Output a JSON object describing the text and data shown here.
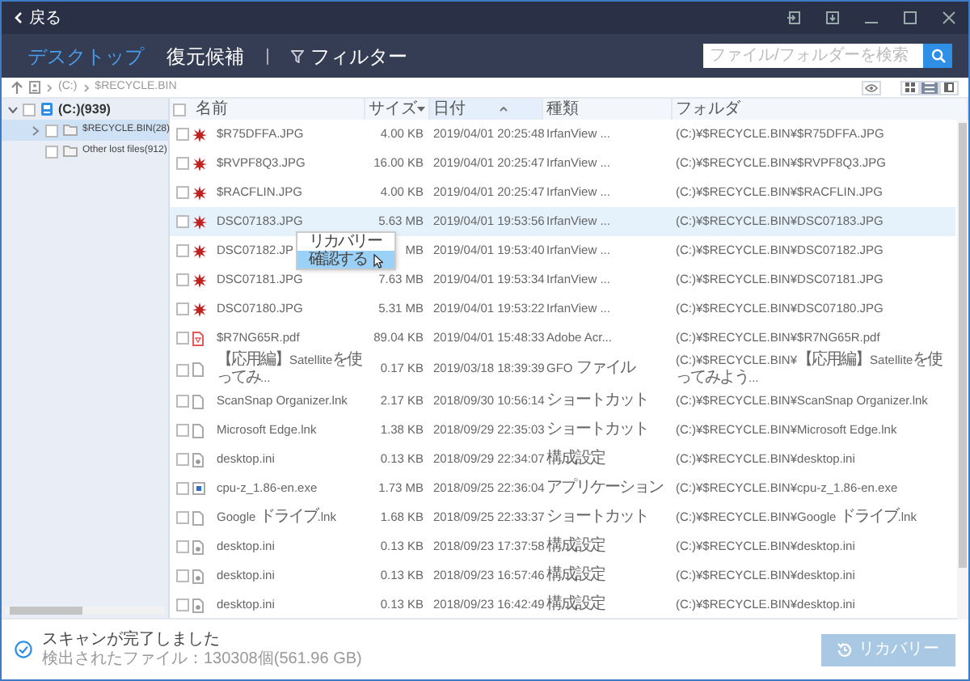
{
  "window": {
    "back": "戻る"
  },
  "tabs": [
    {
      "label": "デスクトップ",
      "selected": true
    },
    {
      "label": "復元候補",
      "selected": false
    }
  ],
  "filter": {
    "label": "フィルター"
  },
  "search": {
    "placeholder": "ファイル/フォルダーを検索"
  },
  "breadcrumb": [
    "(C:)",
    "$RECYCLE.BIN"
  ],
  "views": [
    {
      "kind": "grid",
      "selected": false
    },
    {
      "kind": "list",
      "selected": true
    },
    {
      "kind": "panel",
      "selected": false
    }
  ],
  "tree": [
    {
      "label": "(C:)(939)",
      "kind": "drive",
      "checked": false,
      "selected": false,
      "expanded": true,
      "children": [
        {
          "label": "$RECYCLE.BIN(28)",
          "kind": "folder",
          "checked": false,
          "selected": true,
          "expanded": false
        },
        {
          "label": "Other lost files(912)",
          "kind": "folder",
          "checked": false,
          "selected": false
        }
      ]
    }
  ],
  "table": {
    "select_all": {
      "checked": false
    },
    "columns": [
      {
        "label": "名前",
        "dropdown": false,
        "sorted": false
      },
      {
        "label": "サイズ",
        "dropdown": true,
        "sorted": false
      },
      {
        "label": "日付",
        "dropdown": false,
        "sorted": true
      },
      {
        "label": "種類",
        "dropdown": false,
        "sorted": false
      },
      {
        "label": "フォルダ",
        "dropdown": false,
        "sorted": false
      }
    ],
    "rows": [
      {
        "kind": "image",
        "name": "$R75DFFA.JPG",
        "size": "4.00 KB",
        "date": "2019/04/01 20:25:48",
        "type": "IrfanView ...",
        "folder": "(C:)¥$RECYCLE.BIN¥$R75DFFA.JPG",
        "checked": false,
        "selected": false
      },
      {
        "kind": "image",
        "name": "$RVPF8Q3.JPG",
        "size": "16.00 KB",
        "date": "2019/04/01 20:25:47",
        "type": "IrfanView ...",
        "folder": "(C:)¥$RECYCLE.BIN¥$RVPF8Q3.JPG",
        "checked": false,
        "selected": false
      },
      {
        "kind": "image",
        "name": "$RACFLIN.JPG",
        "size": "4.00 KB",
        "date": "2019/04/01 20:25:47",
        "type": "IrfanView ...",
        "folder": "(C:)¥$RECYCLE.BIN¥$RACFLIN.JPG",
        "checked": false,
        "selected": false
      },
      {
        "kind": "image",
        "name": "DSC07183.JPG",
        "size": "5.63 MB",
        "date": "2019/04/01 19:53:56",
        "type": "IrfanView ...",
        "folder": "(C:)¥$RECYCLE.BIN¥DSC07183.JPG",
        "checked": false,
        "selected": true
      },
      {
        "kind": "image",
        "name": "DSC07182.JP",
        "size": "MB",
        "date": "2019/04/01 19:53:40",
        "type": "IrfanView ...",
        "folder": "(C:)¥$RECYCLE.BIN¥DSC07182.JPG",
        "checked": false,
        "selected": false
      },
      {
        "kind": "image",
        "name": "DSC07181.JPG",
        "size": "7.63 MB",
        "date": "2019/04/01 19:53:34",
        "type": "IrfanView ...",
        "folder": "(C:)¥$RECYCLE.BIN¥DSC07181.JPG",
        "checked": false,
        "selected": false
      },
      {
        "kind": "image",
        "name": "DSC07180.JPG",
        "size": "5.31 MB",
        "date": "2019/04/01 19:53:22",
        "type": "IrfanView ...",
        "folder": "(C:)¥$RECYCLE.BIN¥DSC07180.JPG",
        "checked": false,
        "selected": false
      },
      {
        "kind": "pdf",
        "name": "$R7NG65R.pdf",
        "size": "89.04 KB",
        "date": "2019/04/01 15:48:33",
        "type": "Adobe Acr...",
        "folder": "(C:)¥$RECYCLE.BIN¥$R7NG65R.pdf",
        "checked": false,
        "selected": false
      },
      {
        "kind": "doc",
        "name": "【応用編】Satelliteを使ってみ...",
        "size": "0.17 KB",
        "date": "2019/03/18 18:39:39",
        "type": "GFO ファイル",
        "folder": "(C:)¥$RECYCLE.BIN¥【応用編】Satelliteを使ってみよう...",
        "checked": false,
        "selected": false
      },
      {
        "kind": "doc",
        "name": "ScanSnap Organizer.lnk",
        "size": "2.17 KB",
        "date": "2018/09/30 10:56:14",
        "type": "ショートカット",
        "folder": "(C:)¥$RECYCLE.BIN¥ScanSnap Organizer.lnk",
        "checked": false,
        "selected": false
      },
      {
        "kind": "doc",
        "name": "Microsoft Edge.lnk",
        "size": "1.38 KB",
        "date": "2018/09/29 22:35:03",
        "type": "ショートカット",
        "folder": "(C:)¥$RECYCLE.BIN¥Microsoft Edge.lnk",
        "checked": false,
        "selected": false
      },
      {
        "kind": "config",
        "name": "desktop.ini",
        "size": "0.13 KB",
        "date": "2018/09/29 22:34:07",
        "type": "構成設定",
        "folder": "(C:)¥$RECYCLE.BIN¥desktop.ini",
        "checked": false,
        "selected": false
      },
      {
        "kind": "app",
        "name": "cpu-z_1.86-en.exe",
        "size": "1.73 MB",
        "date": "2018/09/25 22:36:04",
        "type": "アプリケーション",
        "folder": "(C:)¥$RECYCLE.BIN¥cpu-z_1.86-en.exe",
        "checked": false,
        "selected": false
      },
      {
        "kind": "doc",
        "name": "Google ドライブ.lnk",
        "size": "1.68 KB",
        "date": "2018/09/25 22:33:37",
        "type": "ショートカット",
        "folder": "(C:)¥$RECYCLE.BIN¥Google ドライブ.lnk",
        "checked": false,
        "selected": false
      },
      {
        "kind": "config",
        "name": "desktop.ini",
        "size": "0.13 KB",
        "date": "2018/09/23 17:37:58",
        "type": "構成設定",
        "folder": "(C:)¥$RECYCLE.BIN¥desktop.ini",
        "checked": false,
        "selected": false
      },
      {
        "kind": "config",
        "name": "desktop.ini",
        "size": "0.13 KB",
        "date": "2018/09/23 16:57:46",
        "type": "構成設定",
        "folder": "(C:)¥$RECYCLE.BIN¥desktop.ini",
        "checked": false,
        "selected": false
      },
      {
        "kind": "config",
        "name": "desktop.ini",
        "size": "0.13 KB",
        "date": "2018/09/23 16:42:49",
        "type": "構成設定",
        "folder": "(C:)¥$RECYCLE.BIN¥desktop.ini",
        "checked": false,
        "selected": false
      }
    ]
  },
  "context_menu": {
    "items": [
      {
        "label": "リカバリー",
        "selected": false
      },
      {
        "label": "確認する",
        "selected": true
      }
    ]
  },
  "status_bar": {
    "title": "スキャンが完了しました",
    "detail": "検出されたファイル：130308個(561.96 GB)"
  },
  "recover_button": {
    "label": "リカバリー",
    "disabled": true
  }
}
